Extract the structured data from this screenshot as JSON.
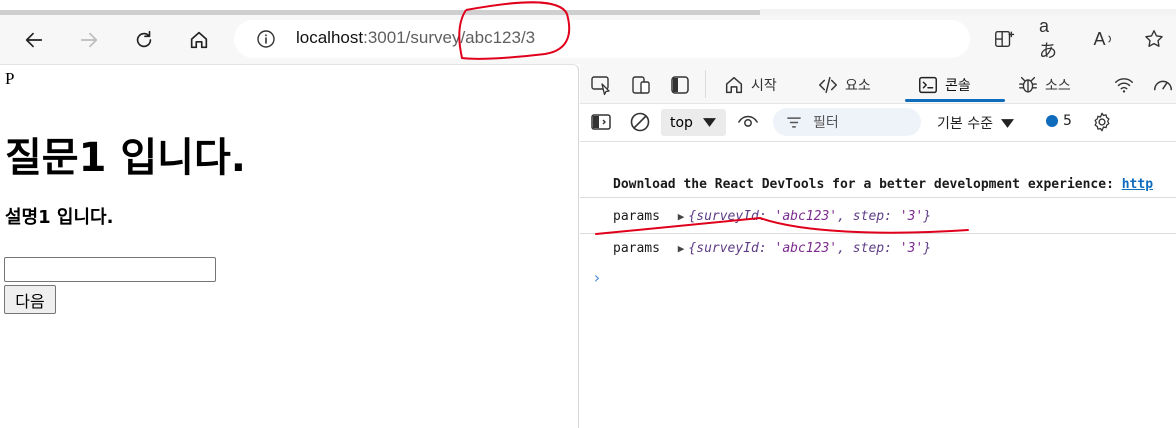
{
  "browser": {
    "address": {
      "host": "localhost",
      "rest": ":3001/survey/abc123/3"
    },
    "icons": [
      "back-icon",
      "forward-icon",
      "refresh-icon",
      "home-icon",
      "info-icon",
      "split-screen-icon",
      "translate-icon",
      "read-aloud-icon",
      "favorite-star-icon"
    ],
    "translate_glyph": "aあ",
    "read_aloud_glyph": "A"
  },
  "page": {
    "p_text": "P",
    "heading": "질문1 입니다.",
    "subheading": "설명1 입니다.",
    "input_value": "",
    "next_button": "다음"
  },
  "devtools": {
    "tabs": [
      {
        "label": "시작",
        "icon": "home-icon"
      },
      {
        "label": "요소",
        "icon": "code-icon"
      },
      {
        "label": "콘솔",
        "icon": "console-icon",
        "active": true
      },
      {
        "label": "소스",
        "icon": "bug-icon"
      }
    ],
    "toolbar": {
      "context": "top",
      "filter_placeholder": "필터",
      "level": "기본 수준",
      "issue_count": "5"
    },
    "console": {
      "message1": "Download the React DevTools for a better development experience: ",
      "message1_link": "http",
      "log_label": "params",
      "log_object_open": "{surveyId: ",
      "log_survey_id": "'abc123'",
      "log_mid": ", step: ",
      "log_step": "'3'",
      "log_close": "}"
    }
  },
  "colors": {
    "accent": "#0f6cbd",
    "annotation": "#e0001b"
  }
}
